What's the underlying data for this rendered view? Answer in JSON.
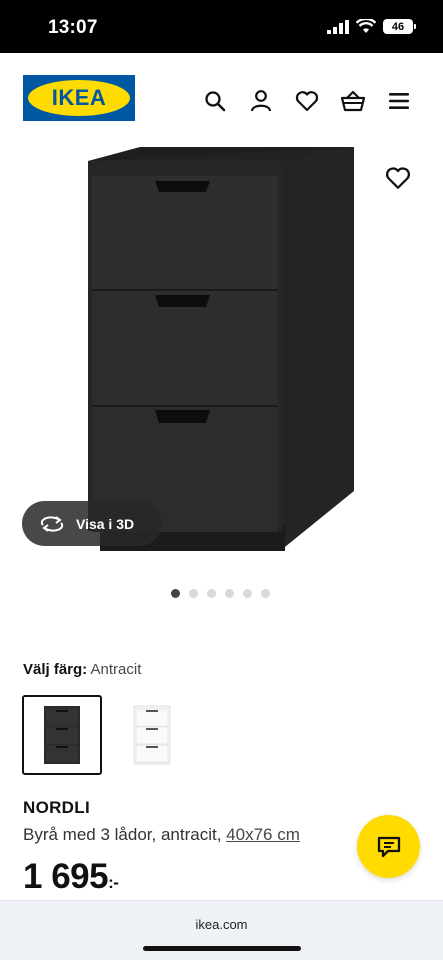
{
  "status_bar": {
    "time": "13:07",
    "battery": "46"
  },
  "header": {
    "logo_text": "IKEA",
    "icons": [
      "search-icon",
      "account-icon",
      "heart-icon",
      "basket-icon",
      "menu-icon"
    ]
  },
  "gallery": {
    "view_3d_label": "Visa i 3D",
    "dot_count": 6,
    "active_dot": 0
  },
  "color": {
    "label": "Välj färg:",
    "value": "Antracit"
  },
  "product": {
    "name": "NORDLI",
    "description": "Byrå med 3 lådor, antracit,",
    "measure": "40x76 cm",
    "price": "1 695",
    "price_suffix": ":-"
  },
  "browser": {
    "url": "ikea.com"
  },
  "colors": {
    "ikea_blue": "#0058a3",
    "ikea_yellow": "#ffdb00",
    "dresser": "#2a2a2a"
  }
}
